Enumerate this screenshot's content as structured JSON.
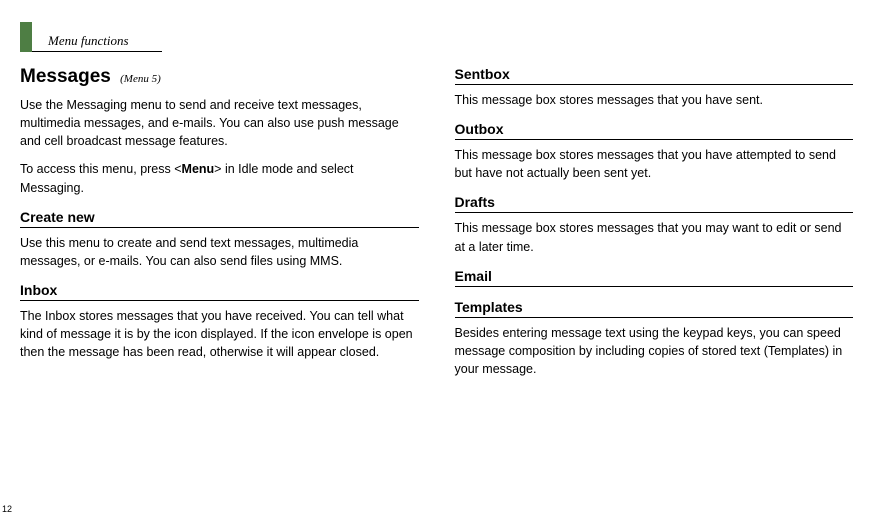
{
  "header": {
    "section": "Menu functions"
  },
  "page_number": "12",
  "left": {
    "title": "Messages",
    "title_annot": "(Menu 5)",
    "intro1": "Use the Messaging menu to send and receive text messages, multimedia messages, and e-mails. You can also use push message and cell broadcast message features.",
    "intro2_pre": "To access this menu, press <",
    "intro2_bold": "Menu",
    "intro2_post": "> in Idle mode and select Messaging.",
    "create_new_title": "Create new",
    "create_new_body": "Use this menu to create and send text messages, multimedia messages, or e-mails. You can also send files using MMS.",
    "inbox_title": "Inbox",
    "inbox_body": "The Inbox stores messages that you have received. You can tell what kind of message it is by the icon displayed. If the icon envelope is open then the message has been read, otherwise it will appear closed."
  },
  "right": {
    "sentbox_title": "Sentbox",
    "sentbox_body": "This message box stores messages that you have sent.",
    "outbox_title": "Outbox",
    "outbox_body": "This message box stores messages that you have attempted to send but have not actually been sent yet.",
    "drafts_title": "Drafts",
    "drafts_body": "This message box stores messages that you may want to edit or send at a later time.",
    "email_title": "Email",
    "templates_title": "Templates",
    "templates_body": "Besides entering message text using the keypad keys, you can speed message composition by including copies of stored text (Templates) in your message."
  }
}
